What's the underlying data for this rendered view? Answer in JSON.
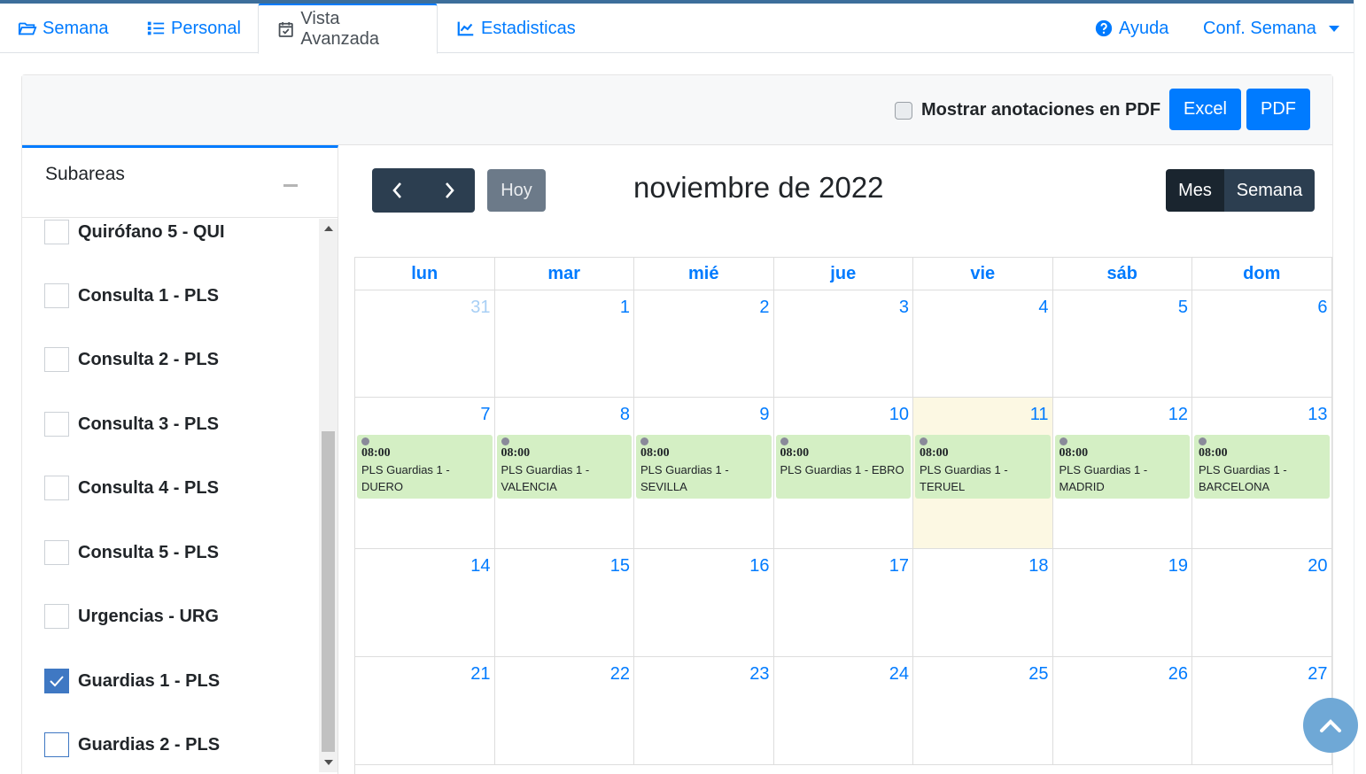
{
  "nav": {
    "tabs": [
      {
        "label": "Semana",
        "icon": "folder-open-icon"
      },
      {
        "label": "Personal",
        "icon": "list-icon"
      },
      {
        "label": "Vista Avanzada",
        "icon": "calendar-check-icon"
      },
      {
        "label": "Estadisticas",
        "icon": "line-chart-icon"
      }
    ],
    "help_label": "Ayuda",
    "config_label": "Conf. Semana"
  },
  "header": {
    "pdf_annotations_label": "Mostrar anotaciones en PDF",
    "pdf_annotations_checked": false,
    "excel_label": "Excel",
    "pdf_label": "PDF"
  },
  "subareas": {
    "title": "Subareas",
    "items": [
      {
        "label": "Quirófano 5 - QUI",
        "checked": false
      },
      {
        "label": "Consulta 1 - PLS",
        "checked": false
      },
      {
        "label": "Consulta 2 - PLS",
        "checked": false
      },
      {
        "label": "Consulta 3 - PLS",
        "checked": false
      },
      {
        "label": "Consulta 4 - PLS",
        "checked": false
      },
      {
        "label": "Consulta 5 - PLS",
        "checked": false
      },
      {
        "label": "Urgencias - URG",
        "checked": false
      },
      {
        "label": "Guardias 1 - PLS",
        "checked": true
      },
      {
        "label": "Guardias 2 - PLS",
        "checked": false
      }
    ]
  },
  "calendar": {
    "today_label": "Hoy",
    "title": "noviembre de 2022",
    "view_month": "Mes",
    "view_week": "Semana",
    "weekdays": [
      "lun",
      "mar",
      "mié",
      "jue",
      "vie",
      "sáb",
      "dom"
    ],
    "weeks": [
      [
        {
          "day": "31",
          "other": true
        },
        {
          "day": "1"
        },
        {
          "day": "2"
        },
        {
          "day": "3"
        },
        {
          "day": "4"
        },
        {
          "day": "5"
        },
        {
          "day": "6"
        }
      ],
      [
        {
          "day": "7",
          "event": {
            "time": "08:00",
            "name": "PLS Guardias 1 - DUERO"
          }
        },
        {
          "day": "8",
          "event": {
            "time": "08:00",
            "name": "PLS Guardias 1 - VALENCIA"
          }
        },
        {
          "day": "9",
          "event": {
            "time": "08:00",
            "name": "PLS Guardias 1 - SEVILLA"
          }
        },
        {
          "day": "10",
          "event": {
            "time": "08:00",
            "name": "PLS Guardias 1 - EBRO"
          }
        },
        {
          "day": "11",
          "today": true,
          "event": {
            "time": "08:00",
            "name": "PLS Guardias 1 - TERUEL"
          }
        },
        {
          "day": "12",
          "event": {
            "time": "08:00",
            "name": "PLS Guardias 1 - MADRID"
          }
        },
        {
          "day": "13",
          "event": {
            "time": "08:00",
            "name": "PLS Guardias 1 - BARCELONA"
          }
        }
      ],
      [
        {
          "day": "14"
        },
        {
          "day": "15"
        },
        {
          "day": "16"
        },
        {
          "day": "17"
        },
        {
          "day": "18"
        },
        {
          "day": "19"
        },
        {
          "day": "20"
        }
      ],
      [
        {
          "day": "21"
        },
        {
          "day": "22"
        },
        {
          "day": "23"
        },
        {
          "day": "24"
        },
        {
          "day": "25"
        },
        {
          "day": "26"
        },
        {
          "day": "27"
        }
      ]
    ]
  },
  "colors": {
    "primary": "#007bff",
    "dark": "#2c3e50",
    "event_bg": "#d4efc4",
    "today_bg": "#fcf8e3"
  }
}
